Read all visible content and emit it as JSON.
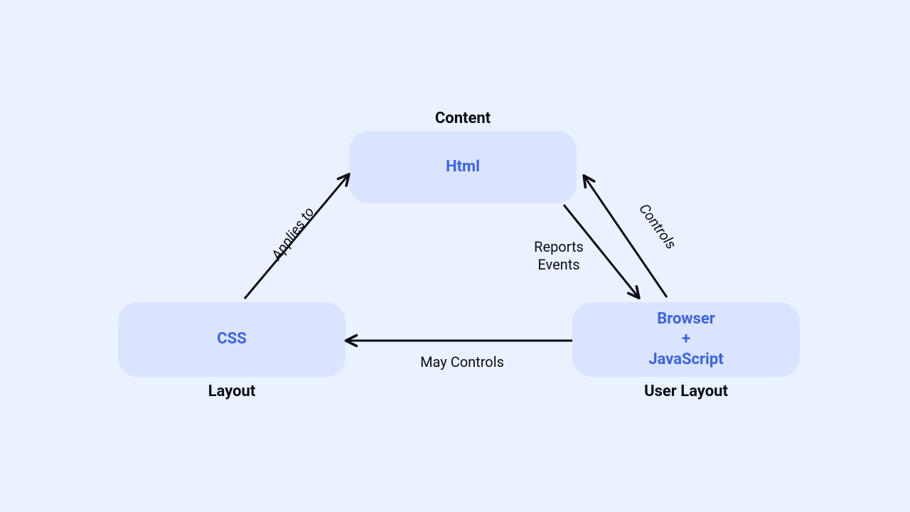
{
  "nodes": {
    "html": {
      "title": "Html",
      "caption": "Content"
    },
    "css": {
      "title": "CSS",
      "caption": "Layout"
    },
    "browser": {
      "line1": "Browser",
      "line2": "+",
      "line3": "JavaScript",
      "caption": "User Layout"
    }
  },
  "edges": {
    "css_to_html": {
      "label": "Applies to"
    },
    "browser_to_html_controls": {
      "label": "Controls"
    },
    "html_to_browser_reports": {
      "label_line1": "Reports",
      "label_line2": "Events"
    },
    "browser_to_css": {
      "label": "May Controls"
    }
  }
}
